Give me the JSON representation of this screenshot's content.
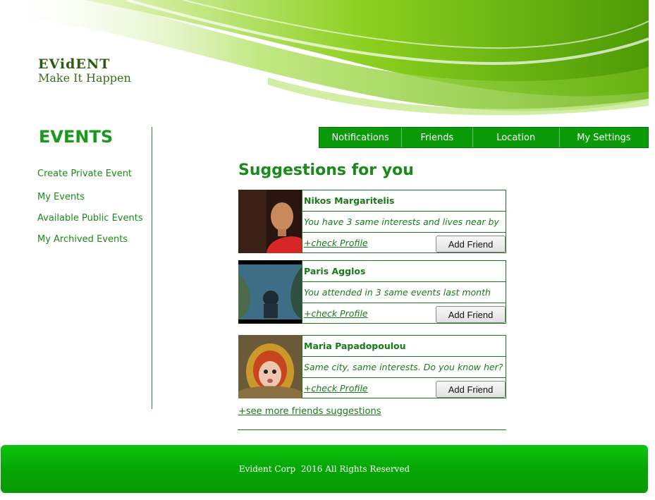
{
  "brand": {
    "name": "EVidENT",
    "tagline": "Make It Happen"
  },
  "sidebar": {
    "title": "EVENTS",
    "links": [
      "Create Private Event",
      "My Events",
      "Available Public Events",
      "My Archived Events"
    ]
  },
  "nav": {
    "items": [
      "Notifications",
      "Friends",
      "Location",
      "My Settings"
    ]
  },
  "suggestions": {
    "title": "Suggestions for you",
    "items": [
      {
        "name": "Nikos Margaritelis",
        "reason": "You have 3 same interests and lives near by",
        "profile_link": "+check Profile",
        "button": "Add Friend"
      },
      {
        "name": "Paris Agglos",
        "reason": "You attended in 3 same events last month",
        "profile_link": "+check Profile",
        "button": "Add Friend"
      },
      {
        "name": "Maria Papadopoulou",
        "reason": "Same city, same interests. Do you know her?",
        "profile_link": "+check Profile",
        "button": "Add Friend"
      }
    ],
    "see_more": "+see more friends suggestions"
  },
  "footer": {
    "text": "Evident Corp  2016 All Rights Reserved"
  },
  "colors": {
    "accent": "#1a8a1a",
    "nav_bg": "#0a9a0a",
    "footer_bg": "#06a806"
  }
}
